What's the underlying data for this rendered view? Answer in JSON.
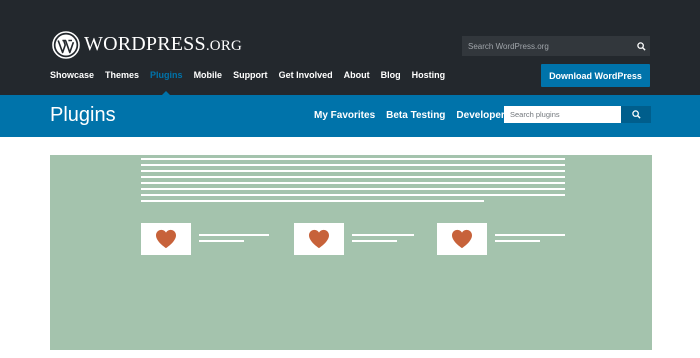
{
  "header": {
    "logo_text": "WordPress",
    "logo_suffix": ".org",
    "search_placeholder": "Search WordPress.org",
    "nav": [
      {
        "label": "Showcase"
      },
      {
        "label": "Themes"
      },
      {
        "label": "Plugins",
        "active": true
      },
      {
        "label": "Mobile"
      },
      {
        "label": "Support"
      },
      {
        "label": "Get Involved"
      },
      {
        "label": "About"
      },
      {
        "label": "Blog"
      },
      {
        "label": "Hosting"
      }
    ],
    "download_label": "Download WordPress"
  },
  "subheader": {
    "title": "Plugins",
    "nav": [
      {
        "label": "My Favorites"
      },
      {
        "label": "Beta Testing"
      },
      {
        "label": "Developers"
      }
    ],
    "search_placeholder": "Search plugins"
  },
  "hero": {
    "cards": [
      {
        "icon": "heart-icon"
      },
      {
        "icon": "heart-icon"
      },
      {
        "icon": "heart-icon"
      }
    ]
  },
  "colors": {
    "header_bg": "#23282d",
    "accent_blue": "#0073aa",
    "hero_bg": "#a4c3ad",
    "heart": "#c7623a"
  }
}
